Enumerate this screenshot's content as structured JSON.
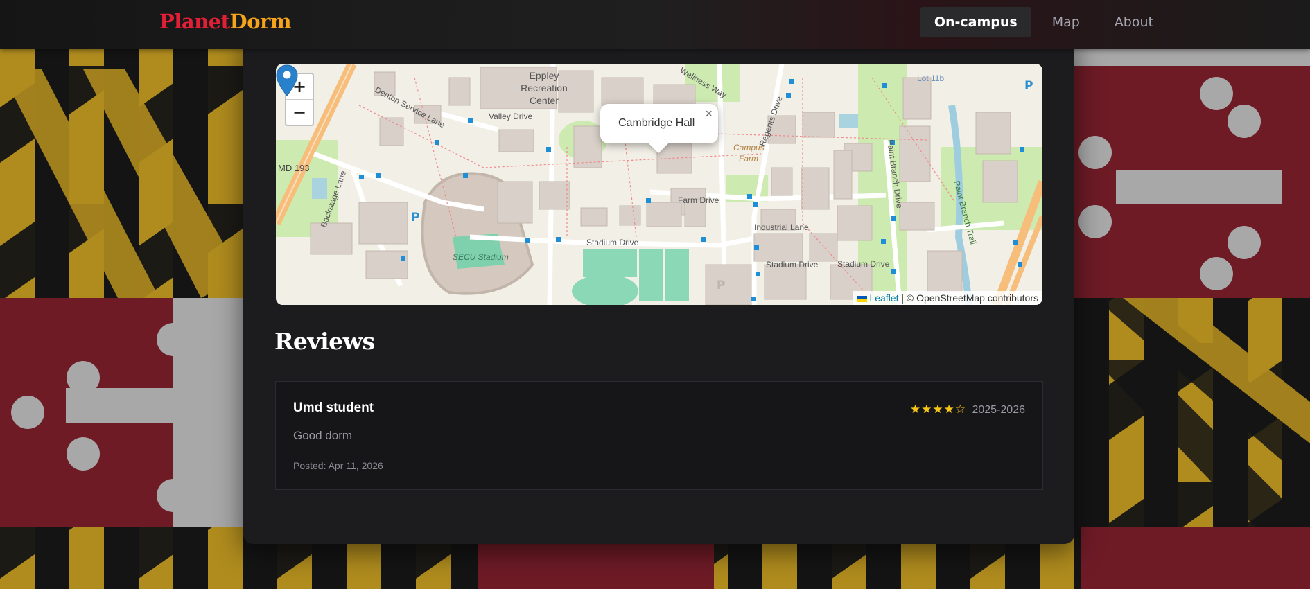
{
  "brand": {
    "part1": "Planet",
    "part2": "Dorm"
  },
  "nav": {
    "items": [
      "On-campus",
      "Map",
      "About"
    ],
    "active": "On-campus"
  },
  "map": {
    "zoom_in": "+",
    "zoom_out": "−",
    "popup": {
      "title": "Cambridge Hall",
      "close": "×"
    },
    "attribution": {
      "link": "Leaflet",
      "rest": "| © OpenStreetMap contributors"
    },
    "labels": {
      "eppley_1": "Eppley",
      "eppley_2": "Recreation",
      "eppley_3": "Center",
      "denton": "Denton Service Lane",
      "valley": "Valley Drive",
      "md193": "MD 193",
      "backstage": "Backstage Lane",
      "secu": "SECU Stadium",
      "stadium1": "Stadium Drive",
      "stadium2": "Stadium Drive",
      "stadium3": "Stadium Drive",
      "farm": "Farm Drive",
      "industrial": "Industrial Lane",
      "regents": "Regents Drive",
      "campus_farm_1": "Campus",
      "campus_farm_2": "Farm",
      "paint_branch": "Paint Branch Drive",
      "paint_trail": "Paint Branch Trail",
      "lot": "Lot 11b",
      "wellness": "Wellness Way"
    }
  },
  "reviews": {
    "heading": "Reviews",
    "items": [
      {
        "author": "Umd student",
        "stars": "★★★★☆",
        "rating": 4,
        "year": "2025-2026",
        "text": "Good dorm",
        "posted": "Posted: Apr 11, 2026"
      }
    ]
  },
  "colors": {
    "brand_red": "#e21f36",
    "brand_gold": "#f5a41b",
    "star": "#f5c518",
    "card_bg": "#1c1c1f"
  }
}
